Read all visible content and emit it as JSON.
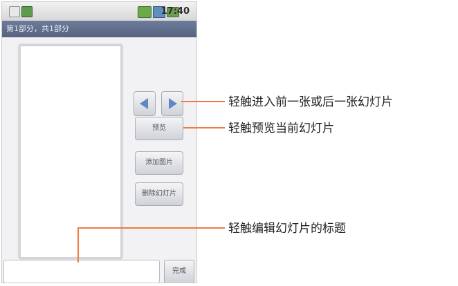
{
  "status_bar": {
    "time": "17:40"
  },
  "part_bar": {
    "text": "第1部分，共1部分"
  },
  "buttons": {
    "preview": "预览",
    "add_picture": "添加图片",
    "delete_slide": "删除幻灯片",
    "done": "完成"
  },
  "title_input": {
    "value": ""
  },
  "callouts": {
    "nav": "轻触进入前一张或后一张幻灯片",
    "preview": "轻触预览当前幻灯片",
    "title": "轻触编辑幻灯片的标题"
  },
  "colors": {
    "callout_line": "#f07a3f",
    "arrow": "#5d88c5",
    "part_bar": "#5f6d8a"
  },
  "icons": {
    "prev": "triangle-left-icon",
    "next": "triangle-right-icon"
  }
}
